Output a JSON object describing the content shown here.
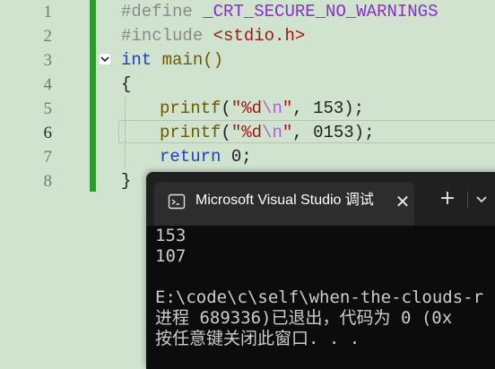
{
  "editor": {
    "line_numbers": [
      "1",
      "2",
      "3",
      "4",
      "5",
      "6",
      "7",
      "8"
    ],
    "line1": {
      "directive": "#define",
      "macro": "_CRT_SECURE_NO_WARNINGS"
    },
    "line2": {
      "directive": "#include",
      "header": "<stdio.h>"
    },
    "line3": {
      "type": "int",
      "name": "main()"
    },
    "line4": {
      "text": "{"
    },
    "line5": {
      "fn": "printf",
      "open": "(",
      "str_a": "\"%d",
      "esc": "\\n",
      "str_b": "\"",
      "rest": ", 153);"
    },
    "line6": {
      "fn": "printf",
      "open": "(",
      "str_a": "\"%d",
      "esc": "\\n",
      "str_b": "\"",
      "rest": ", 0153);"
    },
    "line7": {
      "kw": "return",
      "rest": " 0;"
    },
    "line8": {
      "text": "}"
    }
  },
  "console": {
    "tab_title": "Microsoft Visual Studio 调试",
    "close_glyph": "✕",
    "new_tab_glyph": "+",
    "output": [
      "153",
      "107",
      "",
      "E:\\code\\c\\self\\when-the-clouds-r",
      "进程 689336)已退出，代码为 0 (0x",
      "按任意键关闭此窗口. . ."
    ]
  },
  "colors": {
    "editor_bg": "#cfe3cf",
    "change_bar": "#2c9a2c",
    "console_bg": "#0c0c0c"
  }
}
